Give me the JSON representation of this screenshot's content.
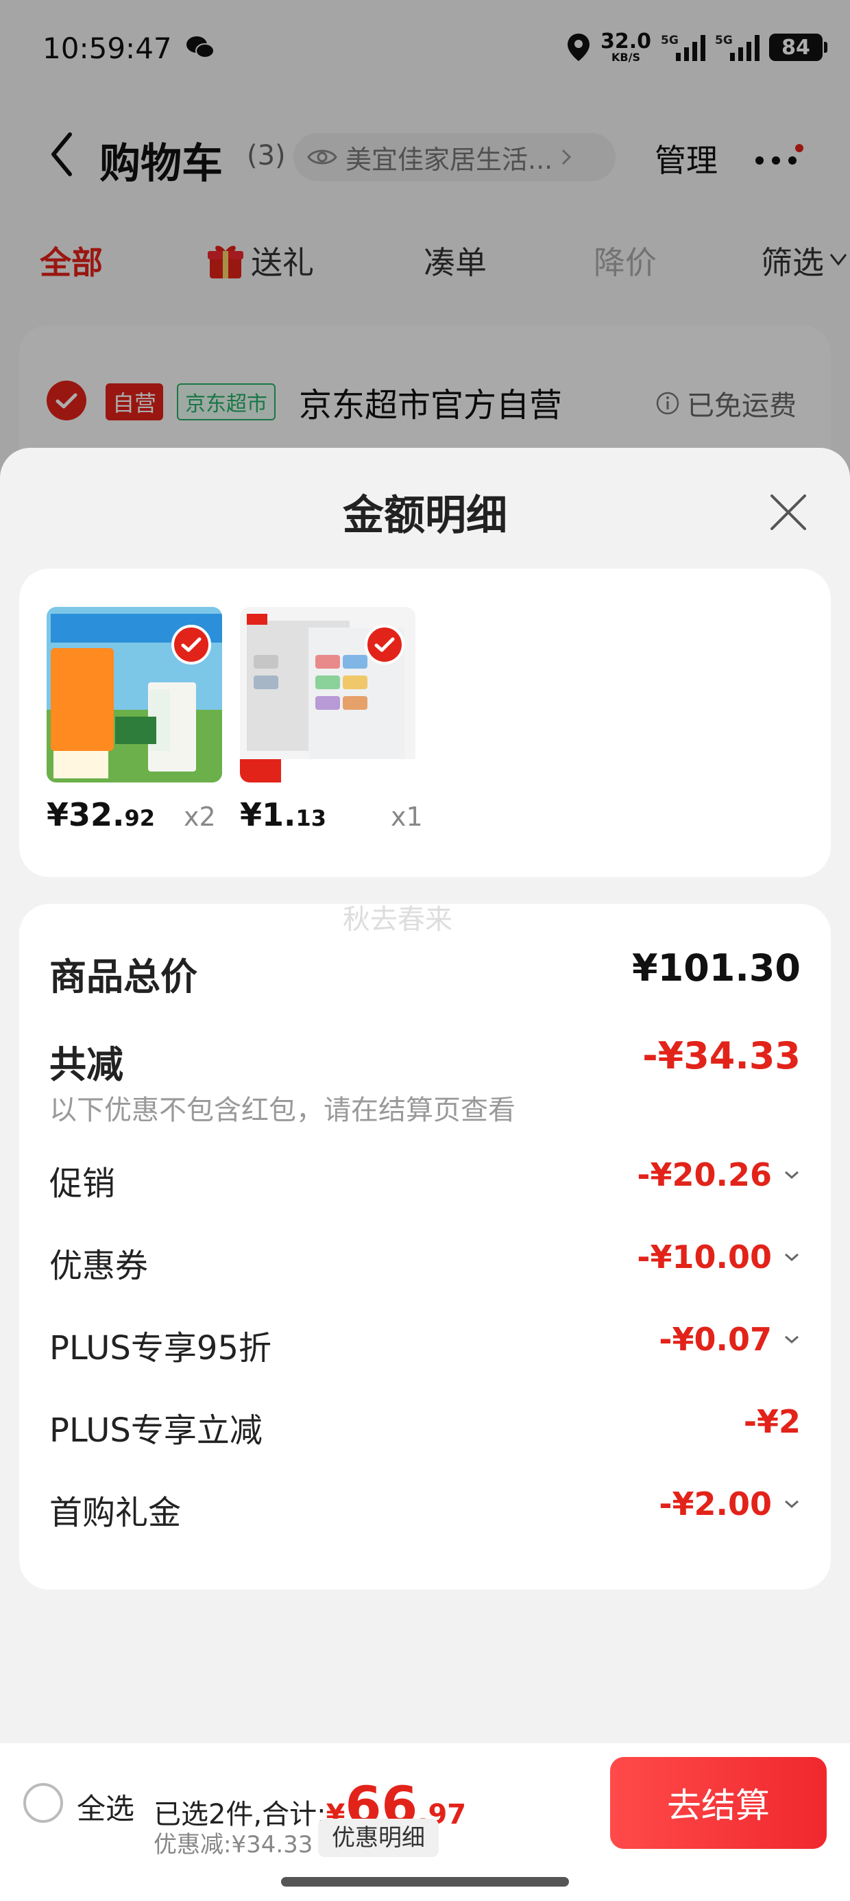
{
  "status_bar": {
    "time": "10:59:47",
    "net_speed": "32.0",
    "net_unit": "KB/S",
    "signal1_tag": "5G",
    "signal2_tag": "5G",
    "battery": "84"
  },
  "header": {
    "title": "购物车",
    "count": "(3)",
    "store_text": "美宜佳家居生活...",
    "manage": "管理"
  },
  "tabs": [
    {
      "label": "全部"
    },
    {
      "label": "送礼"
    },
    {
      "label": "凑单"
    },
    {
      "label": "降价"
    },
    {
      "label": "筛选"
    }
  ],
  "shop_row": {
    "self_badge": "自营",
    "market_badge": "京东超市",
    "shop_name": "京东超市官方自营",
    "shipping": "已免运费"
  },
  "sheet": {
    "title": "金额明细",
    "products": [
      {
        "price_int": "¥32.",
        "price_dec": "92",
        "qty": "x2"
      },
      {
        "price_int": "¥1.",
        "price_dec": "13",
        "qty": "x1"
      }
    ],
    "watermark": "秋去春来",
    "total": {
      "label": "商品总价",
      "value": "¥101.30"
    },
    "reduction": {
      "label": "共减",
      "value": "-¥34.33",
      "note": "以下优惠不包含红包，请在结算页查看"
    },
    "items": [
      {
        "label": "促销",
        "value": "-¥20.26"
      },
      {
        "label": "优惠券",
        "value": "-¥10.00"
      },
      {
        "label": "PLUS专享95折",
        "value": "-¥0.07"
      },
      {
        "label": "PLUS专享立减",
        "value": "-¥2"
      },
      {
        "label": "首购礼金",
        "value": "-¥2.00"
      }
    ]
  },
  "bottom_bar": {
    "select_all": "全选",
    "selected_prefix": "已选2件,合计:",
    "currency": "¥",
    "total_int": "66",
    "total_dec": ".97",
    "discount_text": "优惠减:¥34.33",
    "detail_button": "优惠明细",
    "checkout_button": "去结算"
  },
  "colors": {
    "accent": "#e2231a",
    "green": "#26b067"
  }
}
